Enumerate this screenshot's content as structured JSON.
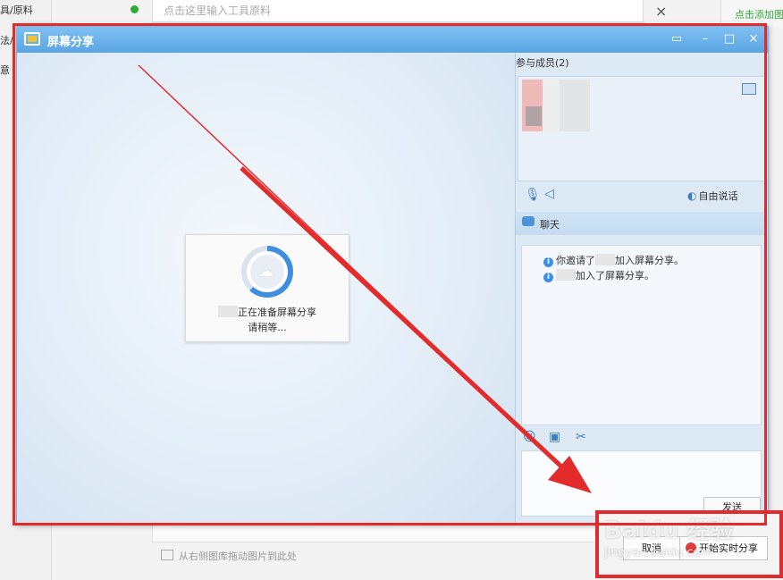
{
  "background": {
    "sidebar_items": [
      "具/原料",
      "法/",
      "意"
    ],
    "input_placeholder": "点击这里输入工具原料",
    "close_glyph": "×",
    "add_image_label": "点击添加图",
    "drag_hint": "从右侧图库拖动图片到此处"
  },
  "window": {
    "title": "屏幕分享",
    "controls": {
      "capture": "▭",
      "minimize": "–",
      "maximize": "□",
      "close": "×"
    }
  },
  "stage": {
    "status_line1": "正在准备屏幕分享",
    "status_line2": "请稍等..."
  },
  "members": {
    "header": "参与成员(2)",
    "free_talk": "自由说话"
  },
  "chat": {
    "header": "聊天",
    "messages": [
      {
        "prefix": "你邀请了",
        "suffix": "加入屏幕分享。"
      },
      {
        "prefix": "",
        "suffix": "加入了屏幕分享。"
      }
    ],
    "send_label": "发送"
  },
  "footer": {
    "cancel_label": "取消",
    "start_label": "开始实时分享"
  },
  "watermark": {
    "logo": "Baidu 经验",
    "url": "jingyan.baidu.com"
  },
  "colors": {
    "annotation": "#e32b2b",
    "titlebar": "#5aa5e4",
    "progress": "#3e8fe0"
  }
}
